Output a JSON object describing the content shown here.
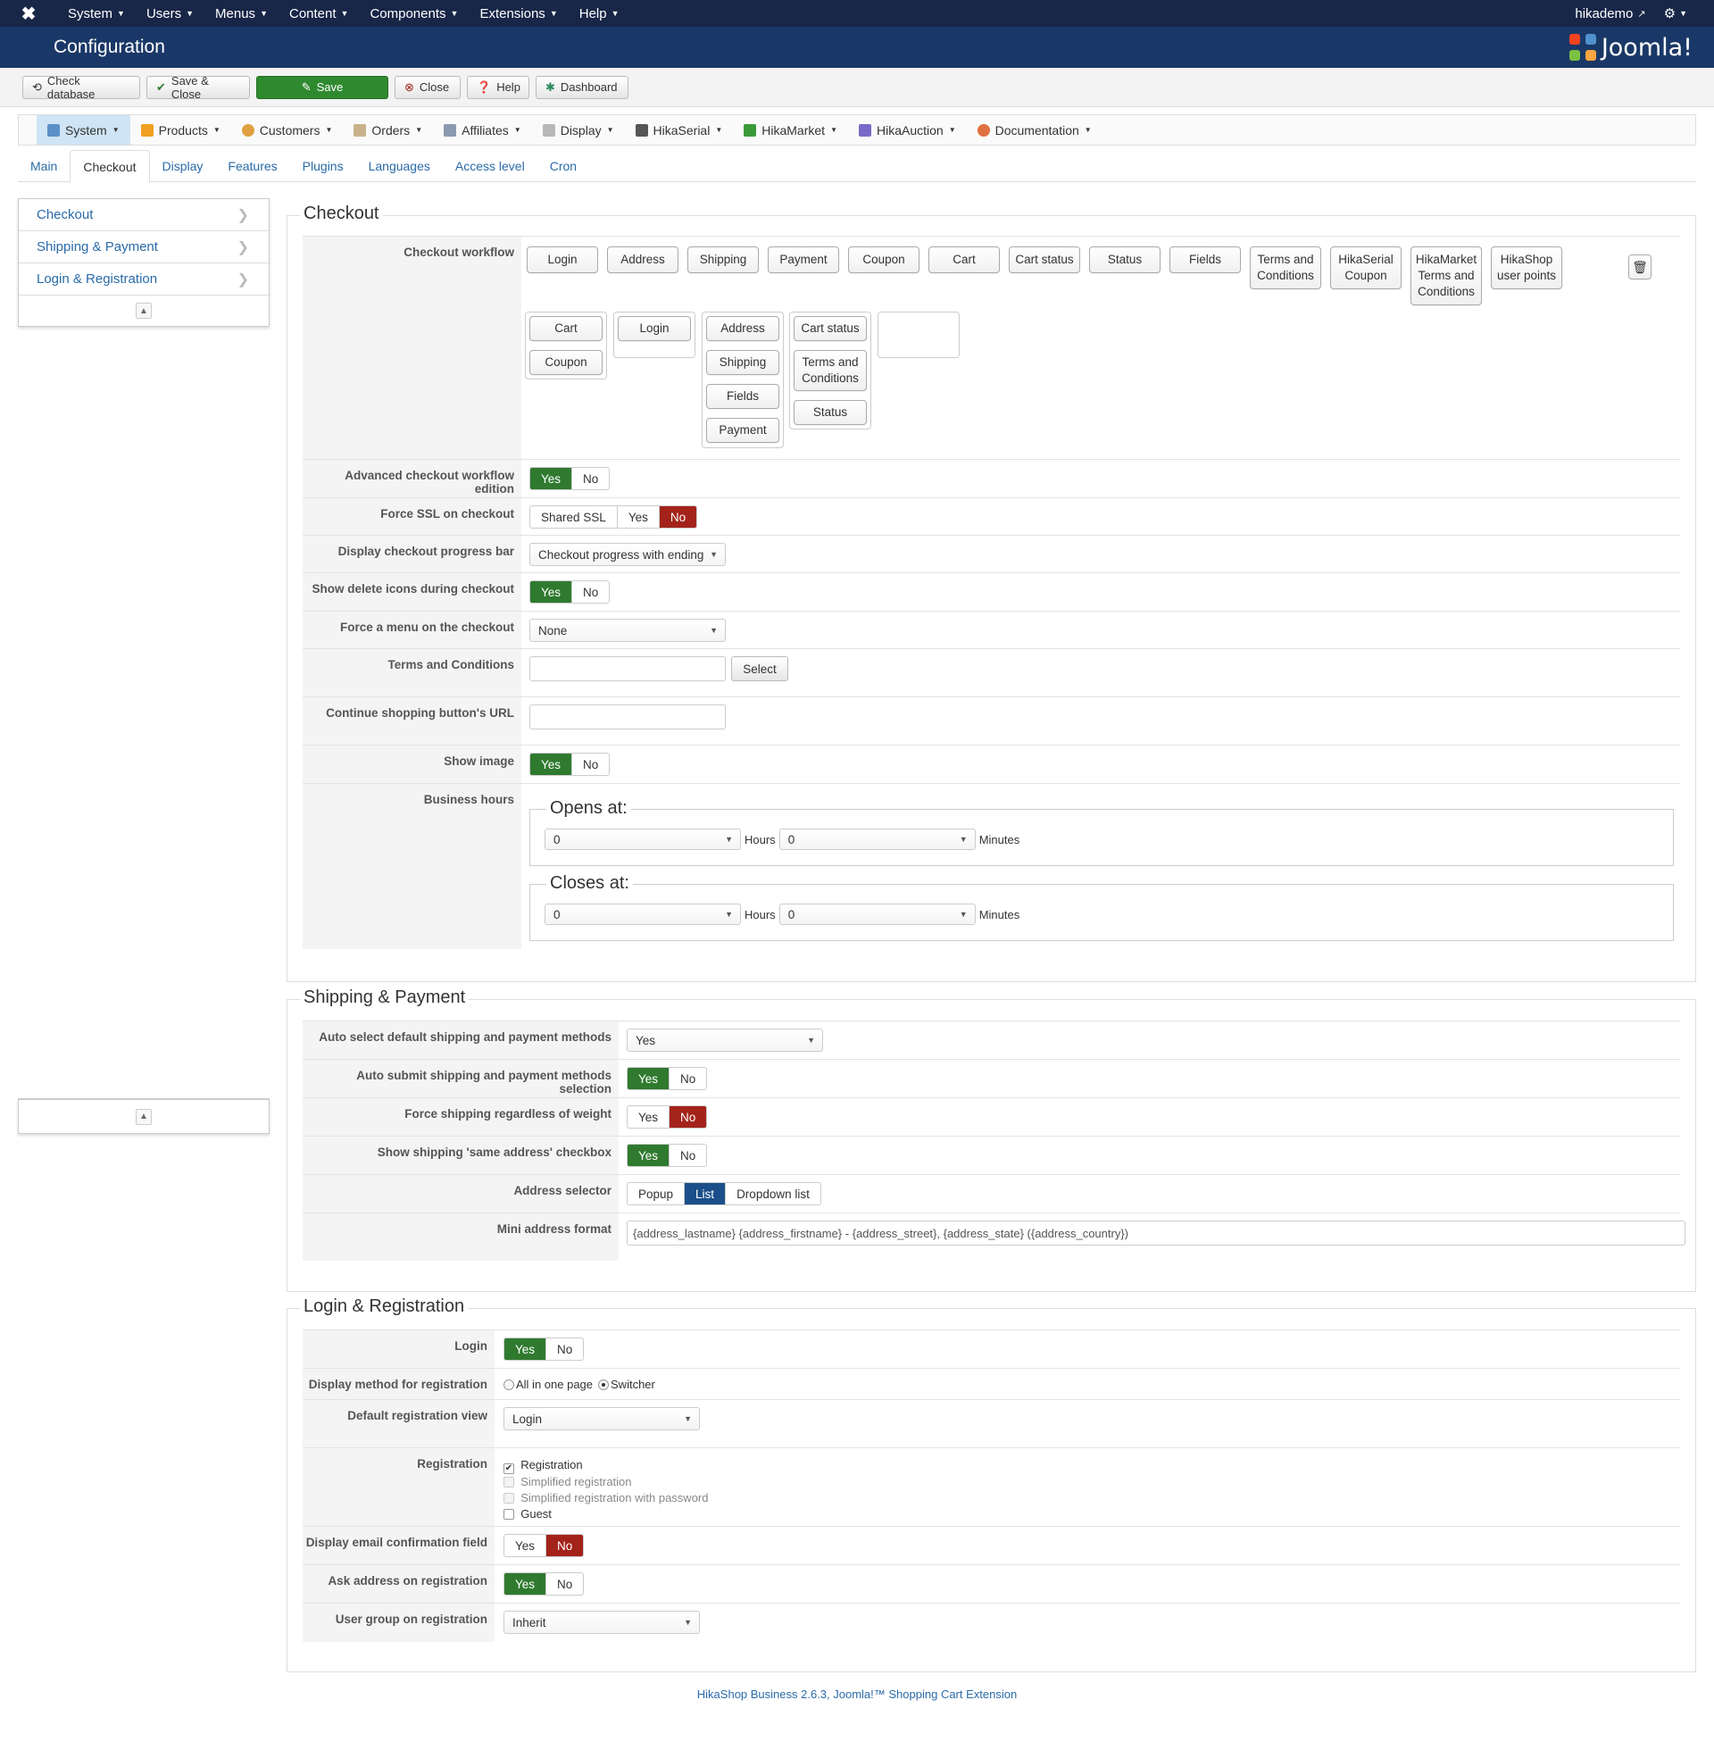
{
  "topbar": {
    "menu": [
      "System",
      "Users",
      "Menus",
      "Content",
      "Components",
      "Extensions",
      "Help"
    ],
    "user": "hikademo"
  },
  "header": {
    "title": "Configuration",
    "brand": "Joomla!"
  },
  "toolbar": {
    "check_db": "Check database",
    "save_close": "Save & Close",
    "save": "Save",
    "close": "Close",
    "help": "Help",
    "dashboard": "Dashboard"
  },
  "hikamenu": [
    "System",
    "Products",
    "Customers",
    "Orders",
    "Affiliates",
    "Display",
    "HikaSerial",
    "HikaMarket",
    "HikaAuction",
    "Documentation"
  ],
  "subtabs": [
    "Main",
    "Checkout",
    "Display",
    "Features",
    "Plugins",
    "Languages",
    "Access level",
    "Cron"
  ],
  "sidenav": [
    "Checkout",
    "Shipping & Payment",
    "Login & Registration"
  ],
  "checkout": {
    "legend": "Checkout",
    "workflow_label": "Checkout workflow",
    "workflow_available": [
      "Login",
      "Address",
      "Shipping",
      "Payment",
      "Coupon",
      "Cart",
      "Cart status",
      "Status",
      "Fields",
      "Terms and Conditions",
      "HikaSerial Coupon",
      "HikaMarket Terms and Conditions",
      "HikaShop user points"
    ],
    "steps": [
      [
        "Cart",
        "Coupon"
      ],
      [
        "Login"
      ],
      [
        "Address",
        "Shipping",
        "Fields",
        "Payment"
      ],
      [
        "Cart status",
        "Terms and Conditions",
        "Status"
      ]
    ],
    "advanced_label": "Advanced checkout workflow edition",
    "force_ssl_label": "Force SSL on checkout",
    "shared_ssl": "Shared SSL",
    "yes": "Yes",
    "no": "No",
    "progress_label": "Display checkout progress bar",
    "progress_value": "Checkout progress with ending",
    "delete_icons_label": "Show delete icons during checkout",
    "force_menu_label": "Force a menu on the checkout",
    "force_menu_value": "None",
    "terms_label": "Terms and Conditions",
    "select_btn": "Select",
    "continue_label": "Continue shopping button's URL",
    "show_image_label": "Show image",
    "business_hours_label": "Business hours",
    "opens_at": "Opens at:",
    "closes_at": "Closes at:",
    "hours_value": "0",
    "minutes_value": "0",
    "hours_text": "Hours",
    "minutes_text": "Minutes"
  },
  "shipping": {
    "legend": "Shipping & Payment",
    "auto_select_label": "Auto select default shipping and payment methods",
    "auto_select_value": "Yes",
    "auto_submit_label": "Auto submit shipping and payment methods selection",
    "force_shipping_label": "Force shipping regardless of weight",
    "same_address_label": "Show shipping 'same address' checkbox",
    "address_selector_label": "Address selector",
    "popup": "Popup",
    "list": "List",
    "dropdown": "Dropdown list",
    "mini_format_label": "Mini address format",
    "mini_format_value": "{address_lastname} {address_firstname} - {address_street}, {address_state} ({address_country})"
  },
  "login": {
    "legend": "Login & Registration",
    "login_label": "Login",
    "display_method_label": "Display method for registration",
    "all_in_one": "All in one page",
    "switcher": "Switcher",
    "default_view_label": "Default registration view",
    "default_view_value": "Login",
    "registration_label": "Registration",
    "reg_options": [
      "Registration",
      "Simplified registration",
      "Simplified registration with password",
      "Guest"
    ],
    "email_confirm_label": "Display email confirmation field",
    "ask_address_label": "Ask address on registration",
    "user_group_label": "User group on registration",
    "user_group_value": "Inherit"
  },
  "footer": "HikaShop Business 2.6.3, Joomla!™ Shopping Cart Extension"
}
